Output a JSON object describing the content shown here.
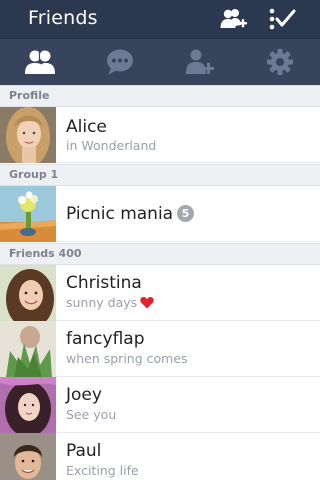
{
  "header": {
    "title": "Friends",
    "add_friend_icon": "add-friend-icon",
    "edit_icon": "checklist-icon"
  },
  "tabs": [
    {
      "icon": "friends-icon",
      "active": true
    },
    {
      "icon": "chat-icon",
      "active": false
    },
    {
      "icon": "add-person-icon",
      "active": false
    },
    {
      "icon": "gear-icon",
      "active": false
    }
  ],
  "sections": {
    "profile": "Profile",
    "group": "Group 1",
    "friends": "Friends 400"
  },
  "profile": {
    "name": "Alice",
    "status": "in Wonderland"
  },
  "group": {
    "name": "Picnic mania",
    "count": "5"
  },
  "friends": [
    {
      "name": "Christina",
      "status": "sunny days"
    },
    {
      "name": "fancyflap",
      "status": "when spring comes"
    },
    {
      "name": "Joey",
      "status": "See you"
    },
    {
      "name": "Paul",
      "status": "Exciting life"
    }
  ],
  "colors": {
    "titlebar": "#2b3850",
    "tabbar": "#37445c",
    "tab_active": "#ffffff",
    "tab_inactive": "#6d7a93",
    "heart": "#e0222a"
  }
}
